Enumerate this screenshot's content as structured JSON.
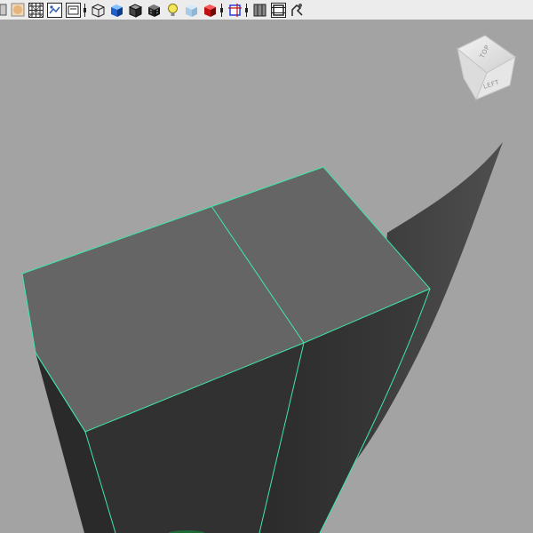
{
  "toolbar": {
    "buttons": [
      {
        "name": "camera-attributes-icon"
      },
      {
        "name": "image-plane-icon"
      },
      {
        "name": "grid-icon"
      },
      {
        "name": "film-gate-icon"
      },
      {
        "name": "resolution-gate-icon"
      },
      {
        "name": "wireframe-icon"
      },
      {
        "name": "smooth-shade-all-icon"
      },
      {
        "name": "wireframe-on-shaded-icon"
      },
      {
        "name": "textured-icon"
      },
      {
        "name": "use-all-lights-icon"
      },
      {
        "name": "xray-icon"
      },
      {
        "name": "shadows-icon"
      },
      {
        "name": "isolate-select-icon"
      },
      {
        "name": "two-sided-lighting-icon"
      },
      {
        "name": "hud-icon"
      },
      {
        "name": "texture-sampling-icon"
      }
    ]
  },
  "viewcube": {
    "top_label": "TOP",
    "left_label": "LEFT"
  },
  "colors": {
    "viewport_bg": "#a3a3a3",
    "selection_edge": "#3fe8a6",
    "top_face": "#656565",
    "side_face": "#333333",
    "shadow_face": "#3a3a3a"
  }
}
